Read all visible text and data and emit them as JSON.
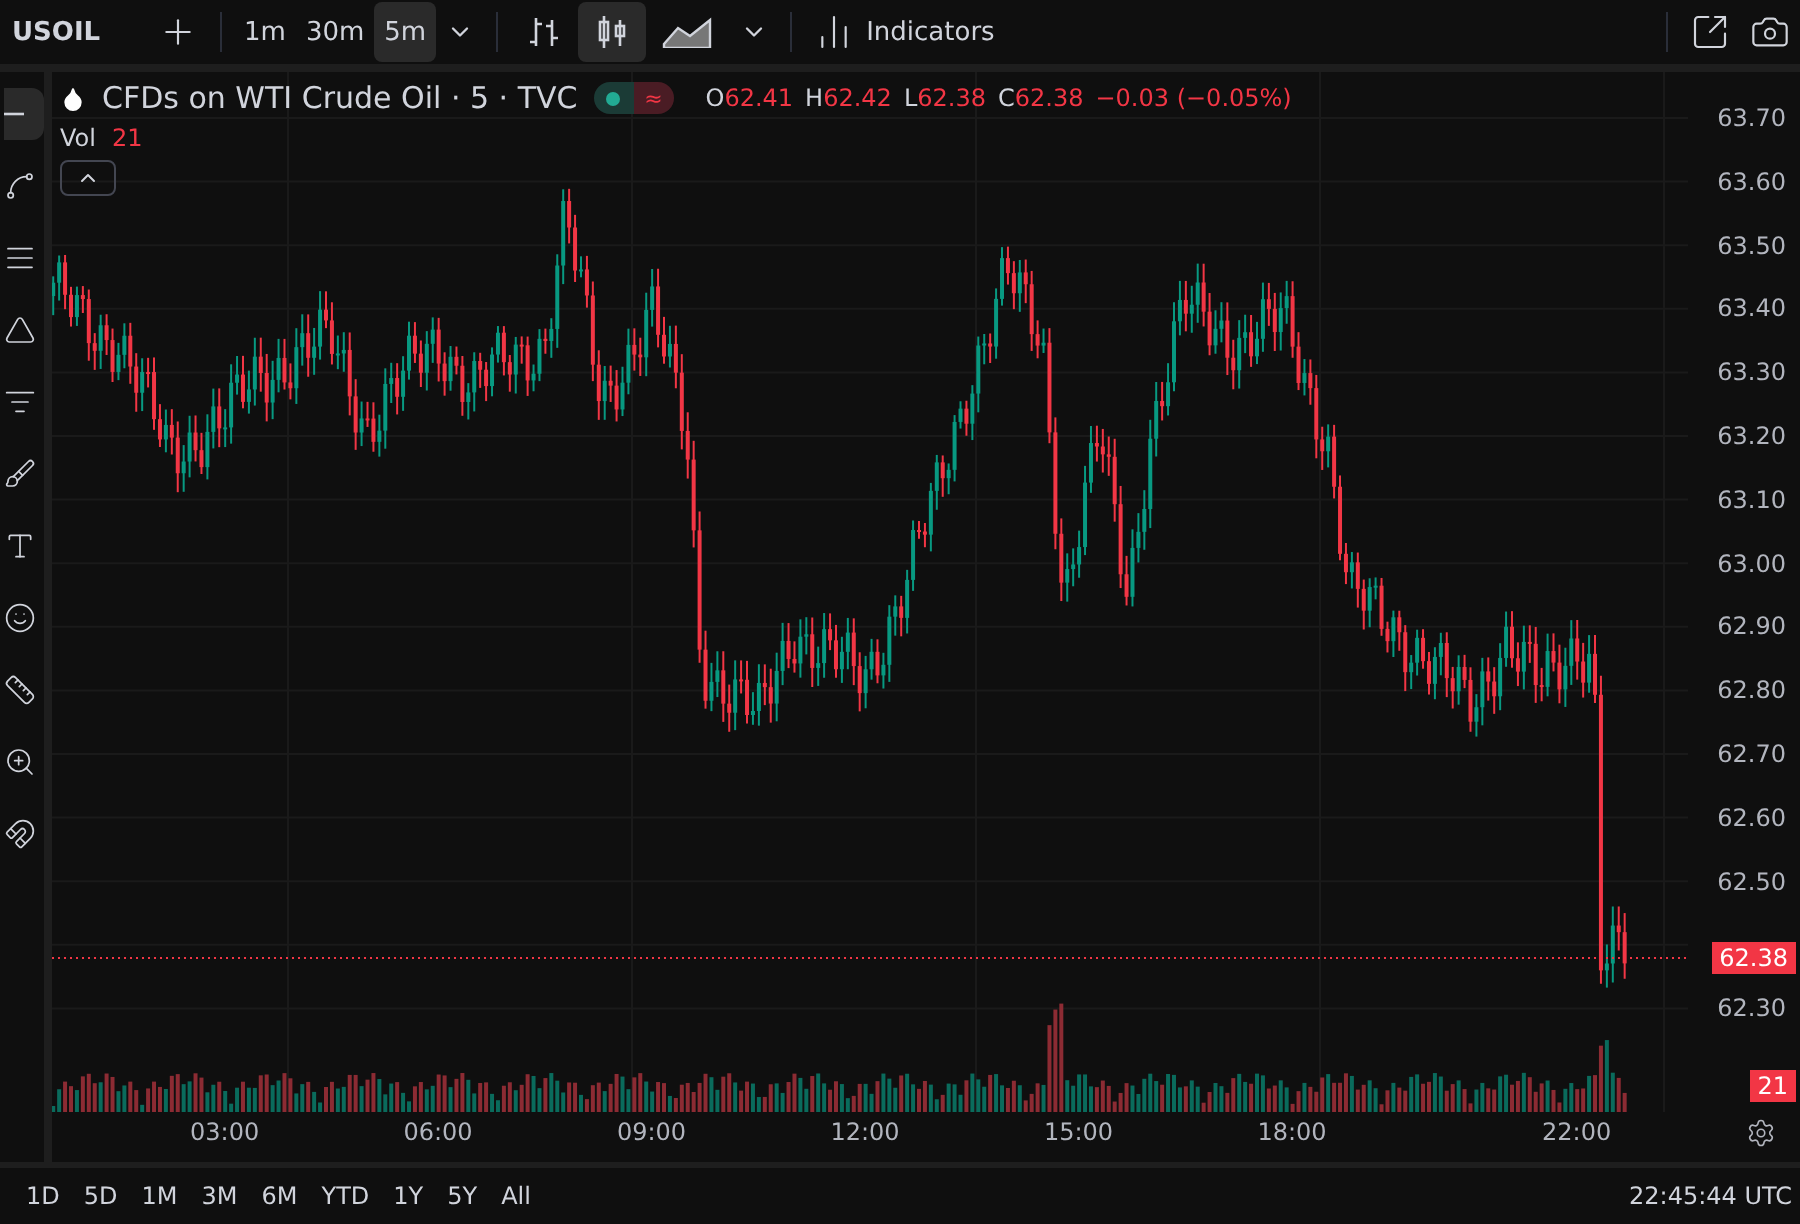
{
  "top_bar": {
    "symbol": "USOIL",
    "intervals": [
      {
        "label": "1m",
        "selected": false
      },
      {
        "label": "30m",
        "selected": false
      },
      {
        "label": "5m",
        "selected": true
      }
    ],
    "chart_styles": [
      {
        "kind": "bars",
        "selected": false
      },
      {
        "kind": "candles",
        "selected": true
      },
      {
        "kind": "area",
        "selected": false
      }
    ],
    "indicators": "Indicators"
  },
  "tools": [
    {
      "kind": "cursor",
      "selected": true
    },
    {
      "kind": "trendline",
      "selected": false
    },
    {
      "kind": "fib",
      "selected": false
    },
    {
      "kind": "pattern",
      "selected": false
    },
    {
      "kind": "projection",
      "selected": false
    },
    {
      "kind": "brush",
      "selected": false
    },
    {
      "kind": "text",
      "selected": false
    },
    {
      "kind": "emoji",
      "selected": false
    },
    {
      "kind": "ruler",
      "selected": false
    },
    {
      "kind": "zoom",
      "selected": false
    },
    {
      "kind": "magnet",
      "selected": false
    }
  ],
  "legend": {
    "title": "CFDs on WTI Crude Oil · 5 · TVC",
    "ohlc": [
      {
        "letter": "O",
        "value": "62.41"
      },
      {
        "letter": "H",
        "value": "62.42"
      },
      {
        "letter": "L",
        "value": "62.38"
      },
      {
        "letter": "C",
        "value": "62.38"
      }
    ],
    "change": "−0.03 (−0.05%)",
    "status_symbol": "≈",
    "volume_label": "Vol",
    "volume_value": "21"
  },
  "price_axis": [
    "63.70",
    "63.60",
    "63.50",
    "63.40",
    "63.30",
    "63.20",
    "63.10",
    "63.00",
    "62.90",
    "62.80",
    "62.70",
    "62.60",
    "62.50",
    "62.30"
  ],
  "last_price": "62.38",
  "volume_badge": "21",
  "time_axis": [
    "03:00",
    "06:00",
    "09:00",
    "12:00",
    "15:00",
    "18:00",
    "22:00"
  ],
  "ranges": [
    "1D",
    "5D",
    "1M",
    "3M",
    "6M",
    "YTD",
    "1Y",
    "5Y",
    "All"
  ],
  "clock": "22:45:44 UTC"
}
